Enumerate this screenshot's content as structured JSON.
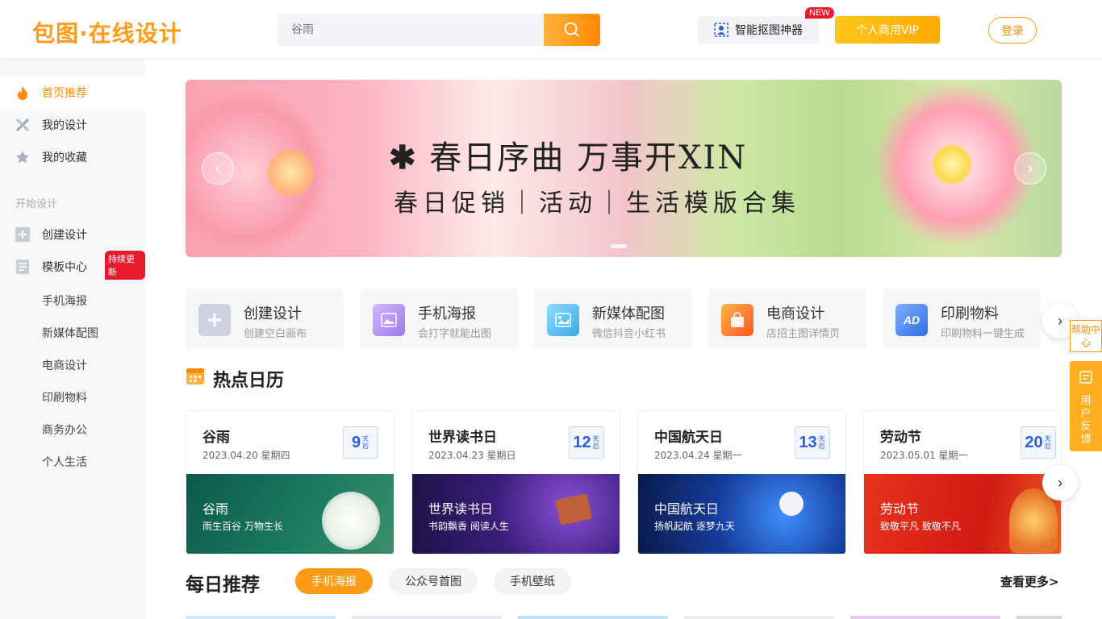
{
  "header": {
    "logo": "包图·在线设计",
    "search_placeholder": "谷雨",
    "matting_label": "智能抠图神器",
    "new_badge": "NEW",
    "vip_label": "个人商用VIP",
    "login_label": "登录"
  },
  "sidebar": {
    "items": [
      {
        "label": "首页推荐",
        "icon": "flame-icon"
      },
      {
        "label": "我的设计",
        "icon": "design-tools-icon"
      },
      {
        "label": "我的收藏",
        "icon": "star-icon"
      }
    ],
    "section_label": "开始设计",
    "create_label": "创建设计",
    "templates_label": "模板中心",
    "templates_badge": "持续更新",
    "sub_items": [
      "手机海报",
      "新媒体配图",
      "电商设计",
      "印刷物料",
      "商务办公",
      "个人生活"
    ]
  },
  "banner": {
    "title": "春日序曲 万事开XIN",
    "subtitle": "春日促销｜活动｜生活模版合集"
  },
  "categories": [
    {
      "title": "创建设计",
      "sub": "创建空白画布",
      "color": "#cdd1e0"
    },
    {
      "title": "手机海报",
      "sub": "会打字就能出图",
      "color": "#b89af0"
    },
    {
      "title": "新媒体配图",
      "sub": "微信抖音小红书",
      "color": "#62c2f2"
    },
    {
      "title": "电商设计",
      "sub": "店招主图详情页",
      "color": "#ff8a2a"
    },
    {
      "title": "印刷物料",
      "sub": "印刷物料一键生成",
      "color": "#4f8df0"
    }
  ],
  "hot_calendar": {
    "title": "热点日历",
    "cards": [
      {
        "name": "谷雨",
        "date": "2023.04.20 星期四",
        "days": "9",
        "unit": "天后",
        "img_title": "谷雨",
        "img_sub": "雨生百谷 万物生长"
      },
      {
        "name": "世界读书日",
        "date": "2023.04.23 星期日",
        "days": "12",
        "unit": "天后",
        "img_title": "世界读书日",
        "img_sub": "书韵飘香 阅读人生"
      },
      {
        "name": "中国航天日",
        "date": "2023.04.24 星期一",
        "days": "13",
        "unit": "天后",
        "img_title": "中国航天日",
        "img_sub": "扬帆起航 逐梦九天"
      },
      {
        "name": "劳动节",
        "date": "2023.05.01 星期一",
        "days": "20",
        "unit": "天后",
        "img_title": "劳动节",
        "img_sub": "致敬平凡 致敬不凡"
      }
    ]
  },
  "daily": {
    "title": "每日推荐",
    "tabs": [
      "手机海报",
      "公众号首图",
      "手机壁纸"
    ],
    "more_label": "查看更多>"
  },
  "floating": {
    "help_label": "帮助中心",
    "feedback_label": "用户反馈"
  },
  "colors": {
    "accent": "#ff9a14",
    "badge_red": "#e8192c"
  }
}
